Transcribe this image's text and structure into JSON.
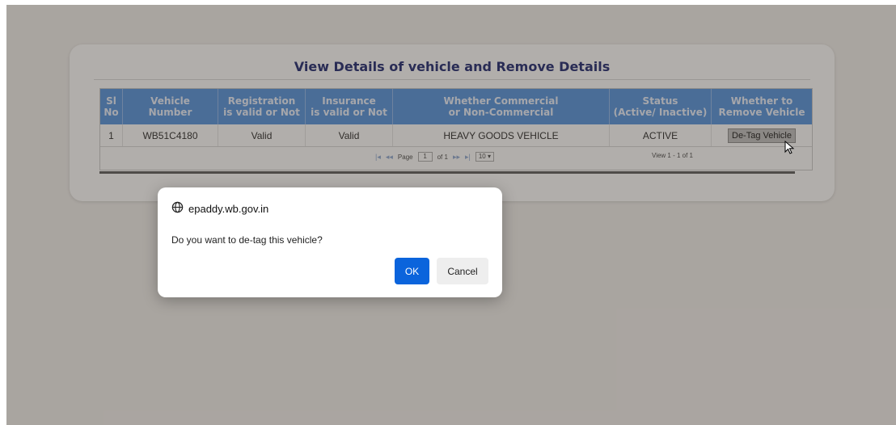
{
  "page": {
    "title": "View Details of vehicle and Remove Details",
    "columns": [
      "Sl No",
      "Vehicle\nNumber",
      "Registration\nis valid or Not",
      "Insurance\nis valid or Not",
      "Whether Commercial\nor Non-Commercial",
      "Status\n(Active/ Inactive)",
      "Whether to\nRemove Vehicle"
    ],
    "rows": [
      {
        "sl_no": "1",
        "vehicle_number": "WB51C4180",
        "registration": "Valid",
        "insurance": "Valid",
        "commercial": "HEAVY GOODS VEHICLE",
        "status": "ACTIVE",
        "action": "De-Tag Vehicle"
      }
    ],
    "pager": {
      "page_label": "Page",
      "page_value": "1",
      "of_label": "of 1",
      "page_size": "10",
      "view_text": "View 1 - 1 of 1"
    }
  },
  "dialog": {
    "origin": "epaddy.wb.gov.in",
    "message": "Do you want to de-tag this vehicle?",
    "ok_label": "OK",
    "cancel_label": "Cancel",
    "origin_icon": "globe-icon"
  },
  "colors": {
    "header_bg": "#4f8fdc",
    "title_color": "#16206b",
    "ok_button": "#0b64dc"
  }
}
